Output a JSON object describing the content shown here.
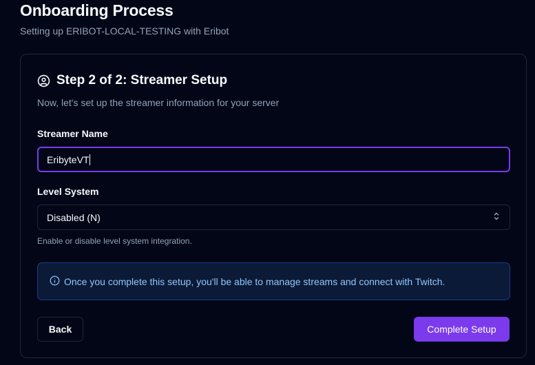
{
  "page": {
    "title": "Onboarding Process",
    "subtitle": "Setting up ERIBOT-LOCAL-TESTING with Eribot"
  },
  "step": {
    "title": "Step 2 of 2: Streamer Setup",
    "description": "Now, let's set up the streamer information for your server",
    "icon": "user-circle-icon"
  },
  "form": {
    "streamer_name": {
      "label": "Streamer Name",
      "value": "EribyteVT"
    },
    "level_system": {
      "label": "Level System",
      "value": "Disabled (N)",
      "help": "Enable or disable level system integration."
    }
  },
  "alert": {
    "icon": "info-icon",
    "text": "Once you complete this setup, you'll be able to manage streams and connect with Twitch."
  },
  "buttons": {
    "back": "Back",
    "complete": "Complete Setup"
  },
  "colors": {
    "background": "#020617",
    "accent": "#7c3aed",
    "alert_text": "#93c5fd",
    "alert_border": "#1e3a8a",
    "muted_text": "#94a3b8"
  }
}
